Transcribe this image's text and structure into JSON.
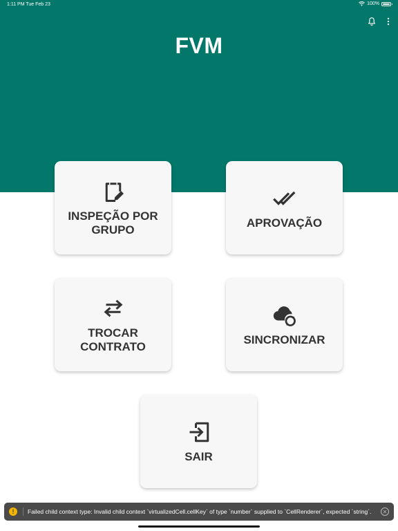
{
  "status_bar": {
    "time_date": "1:11 PM  Tue Feb 23",
    "battery": "100%"
  },
  "header": {
    "title": "FVM",
    "background_color": "#03776a",
    "icons": [
      "bell-icon",
      "more-vertical-icon"
    ]
  },
  "menu": {
    "items": [
      {
        "label": "INSPEÇÃO POR\nGRUPO",
        "icon": "clipboard-edit-icon"
      },
      {
        "label": "APROVAÇÃO",
        "icon": "double-check-icon"
      },
      {
        "label": "TROCAR\nCONTRATO",
        "icon": "swap-arrows-icon"
      },
      {
        "label": "SINCRONIZAR",
        "icon": "cloud-sync-icon"
      },
      {
        "label": "SAIR",
        "icon": "exit-icon"
      }
    ]
  },
  "toast": {
    "message": "Failed child context type: Invalid child context `virtualizedCell.cellKey` of type `number` supplied to `CellRenderer`, expected `string`.",
    "warning_glyph": "!",
    "close_glyph": "✕"
  }
}
